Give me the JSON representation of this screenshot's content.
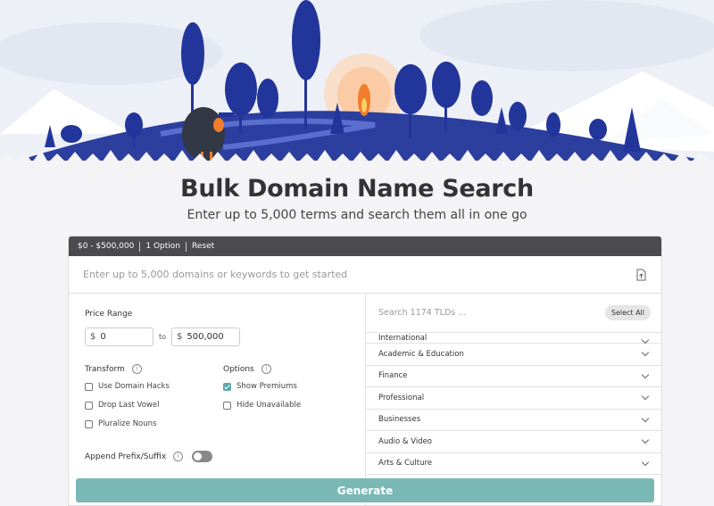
{
  "colors": {
    "accent": "#7ab8b6",
    "topbar": "#4a4a4f",
    "forest": "#2c3f9e",
    "fire": "#f07c2c"
  },
  "header": {
    "title": "Bulk Domain Name Search",
    "subtitle": "Enter up to 5,000 terms and search them all in one go"
  },
  "filter_bar": {
    "price": "$0 - $500,000",
    "options": "1 Option",
    "reset": "Reset"
  },
  "search": {
    "placeholder": "Enter up to 5,000 domains or keywords to get started",
    "upload_icon": "file-upload-icon"
  },
  "price_range": {
    "label": "Price Range",
    "currency": "$",
    "min": "0",
    "to_label": "to",
    "max": "500,000"
  },
  "transform": {
    "label": "Transform",
    "items": [
      {
        "label": "Use Domain Hacks",
        "checked": false
      },
      {
        "label": "Drop Last Vowel",
        "checked": false
      },
      {
        "label": "Pluralize Nouns",
        "checked": false
      }
    ]
  },
  "options": {
    "label": "Options",
    "items": [
      {
        "label": "Show Premiums",
        "checked": true
      },
      {
        "label": "Hide Unavailable",
        "checked": false
      }
    ]
  },
  "append": {
    "label": "Append Prefix/Suffix",
    "enabled": false
  },
  "tlds": {
    "placeholder": "Search 1174 TLDs ...",
    "select_all": "Select All",
    "categories": [
      "International",
      "Academic & Education",
      "Finance",
      "Professional",
      "Businesses",
      "Audio & Video",
      "Arts & Culture"
    ]
  },
  "generate": "Generate"
}
